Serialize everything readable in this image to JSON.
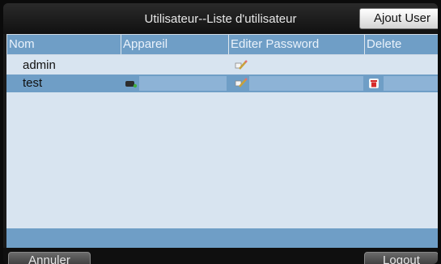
{
  "header": {
    "title": "Utilisateur--Liste d'utilisateur",
    "add_user_label": "Ajout User"
  },
  "table": {
    "columns": [
      "Nom",
      "Appareil",
      "Editer Password",
      "Delete"
    ],
    "rows": [
      {
        "name": "admin",
        "device_icon": false,
        "edit_icon": "edit-password-icon",
        "delete_icon": false,
        "selected": false
      },
      {
        "name": "test",
        "device_icon": "device-icon",
        "edit_icon": "edit-password-icon",
        "delete_icon": "trash-icon",
        "selected": true
      }
    ]
  },
  "footer": {
    "cancel_label": "Annuler",
    "logout_label": "Logout"
  },
  "colors": {
    "header_blue": "#6f9ec6",
    "table_bg": "#d8e4f0",
    "trash_red": "#d62a2a"
  }
}
